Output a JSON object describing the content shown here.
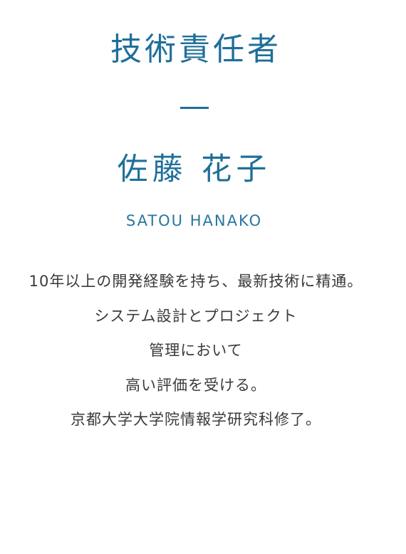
{
  "profile": {
    "role": "技術責任者",
    "name": "佐藤 花子",
    "romaji": "SATOU HANAKO",
    "bio_lines": [
      "10年以上の開発経験を持ち、最新技術に精通。",
      "システム設計とプロジェクト",
      "管理において",
      "高い評価を受ける。",
      "京都大学大学院情報学研究科修了。"
    ]
  },
  "colors": {
    "accent": "#1f6f99",
    "body_text": "#3a3a3a",
    "background": "#ffffff"
  }
}
